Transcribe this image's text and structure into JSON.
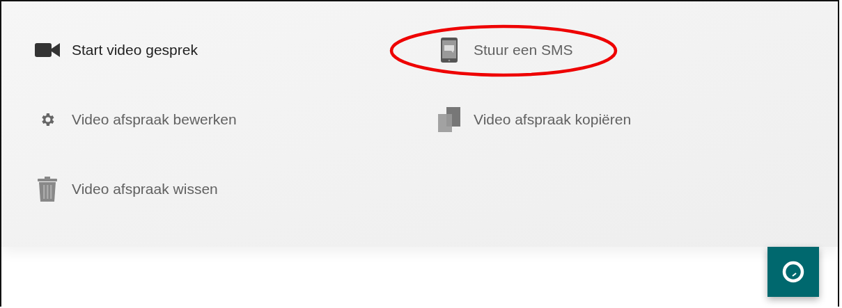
{
  "actions": [
    {
      "label": "Start video gesprek",
      "emphasized": true,
      "highlighted": false
    },
    {
      "label": "Stuur een SMS",
      "emphasized": false,
      "highlighted": true
    },
    {
      "label": "Video afspraak bewerken",
      "emphasized": false,
      "highlighted": false
    },
    {
      "label": "Video afspraak kopiëren",
      "emphasized": false,
      "highlighted": false
    },
    {
      "label": "Video afspraak wissen",
      "emphasized": false,
      "highlighted": false
    }
  ]
}
